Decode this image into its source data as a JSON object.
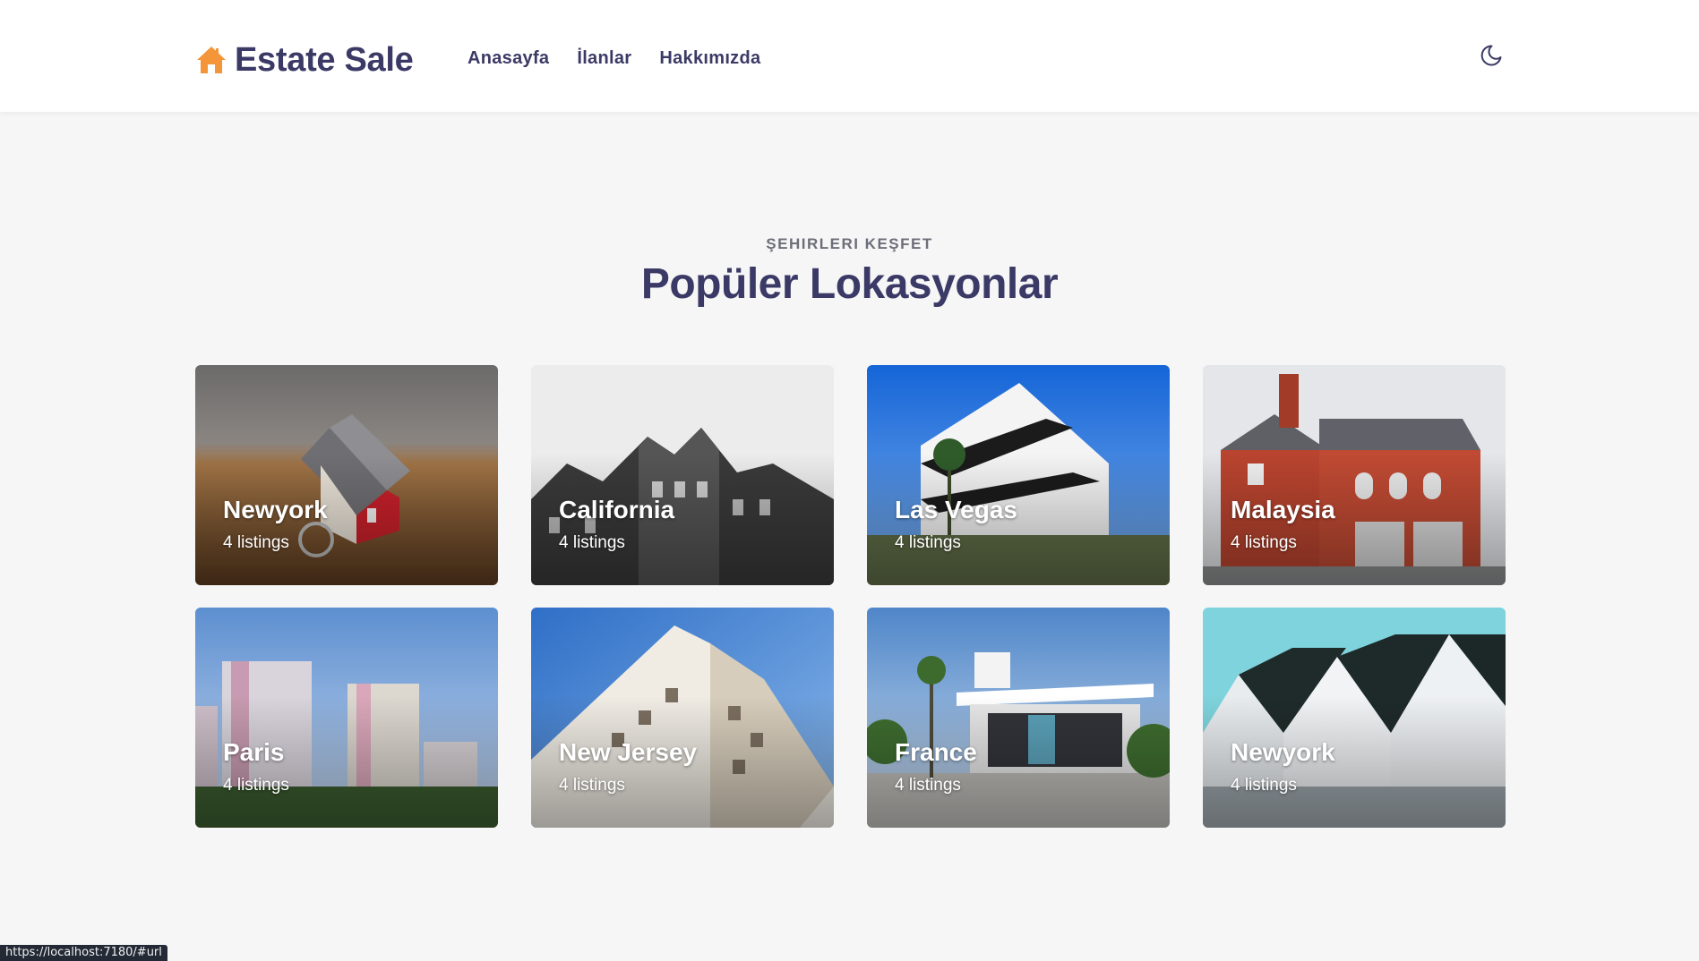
{
  "header": {
    "brand": "Estate Sale",
    "nav": [
      {
        "label": "Anasayfa"
      },
      {
        "label": "İlanlar"
      },
      {
        "label": "Hakkımızda"
      }
    ],
    "theme_icon": "moon-icon"
  },
  "section": {
    "eyebrow": "ŞEHIRLERI KEŞFET",
    "title": "Popüler Lokasyonlar"
  },
  "cards": [
    {
      "city": "Newyork",
      "count": "4 listings"
    },
    {
      "city": "California",
      "count": "4 listings"
    },
    {
      "city": "Las Vegas",
      "count": "4 listings"
    },
    {
      "city": "Malaysia",
      "count": "4 listings"
    },
    {
      "city": "Paris",
      "count": "4 listings"
    },
    {
      "city": "New Jersey",
      "count": "4 listings"
    },
    {
      "city": "France",
      "count": "4 listings"
    },
    {
      "city": "Newyork",
      "count": "4 listings"
    }
  ],
  "status_bar": {
    "url": "https://localhost:7180/#url"
  },
  "colors": {
    "brand_text": "#3b3a66",
    "brand_icon": "#f4953a",
    "page_bg": "#f6f6f7"
  }
}
